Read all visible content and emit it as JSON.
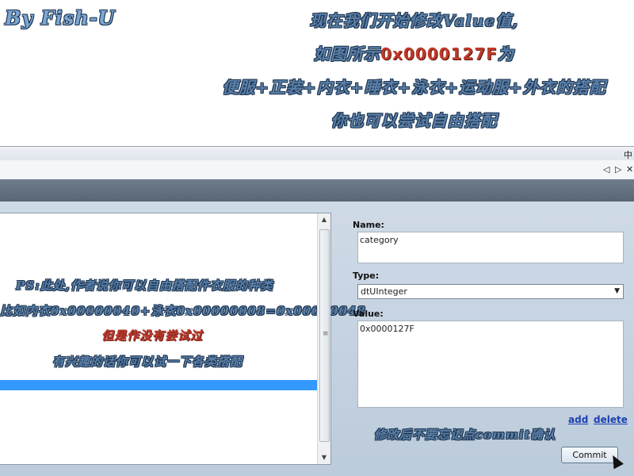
{
  "banner": {
    "author": "By Fish-U",
    "line1": "现在我们开始修改Value值,",
    "line2_prefix": "如图所示",
    "line2_value": "0x0000127F",
    "line2_suffix": "为",
    "line3": "便服+正装+内衣+睡衣+泳衣+运动服+外衣的搭配",
    "line4": "你也可以尝试自由搭配"
  },
  "toolbar": {
    "pin_glyph": "中",
    "prev_glyph": "◁",
    "next_glyph": "▷",
    "close_glyph": "✕"
  },
  "list_notes": {
    "note1": "PS:此处,作者说你可以自由搭配件衣服的种类",
    "note2": "比如内衣0x00000040+泳衣0x00000008=0x00000048",
    "note3": "但是作没有尝试过",
    "note4": "有兴趣的话你可以试一下各类搭配"
  },
  "form": {
    "name_label": "Name:",
    "name_value": "category",
    "type_label": "Type:",
    "type_value": "dtUInteger",
    "value_label": "Value:",
    "value_value": "0x0000127F",
    "add_label": "add",
    "delete_label": "delete",
    "reminder": "修改后不要忘记点commit确认",
    "commit_label": "Commit"
  },
  "colors": {
    "accent": "#3399ff",
    "highlight_red": "#c0392b",
    "header_bar": "#627080",
    "panel_bg": "#c6d3e1"
  }
}
